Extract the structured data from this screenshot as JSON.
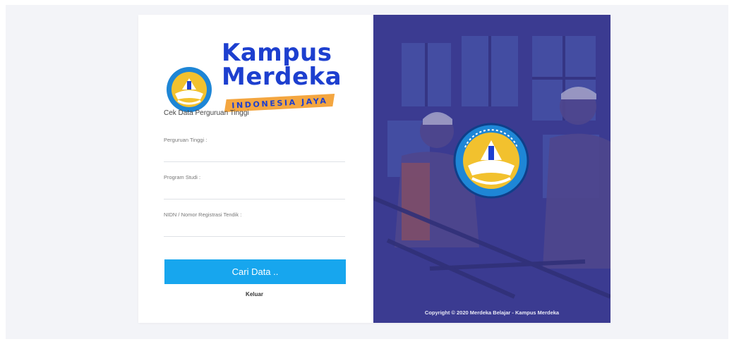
{
  "brand": {
    "line1": "Kampus",
    "line2": "Merdeka",
    "tagline": "INDONESIA JAYA",
    "color": "#1d3fcf",
    "accent": "#f4a640"
  },
  "form": {
    "heading": "Cek Data Perguruan Tinggi",
    "fields": [
      {
        "label": "Perguruan Tinggi :",
        "value": ""
      },
      {
        "label": "Program Studi :",
        "value": ""
      },
      {
        "label": "NIDN / Nomor Registrasi Tendik :",
        "value": ""
      }
    ],
    "submit_label": "Cari Data ..",
    "logout_label": "Keluar"
  },
  "hero": {
    "emblem": "tut-wuri-handayani-emblem",
    "copyright": "Copyright © 2020 Merdeka Belajar - Kampus Merdeka"
  },
  "colors": {
    "button": "#17a6ee",
    "overlay": "#3c3c93"
  }
}
